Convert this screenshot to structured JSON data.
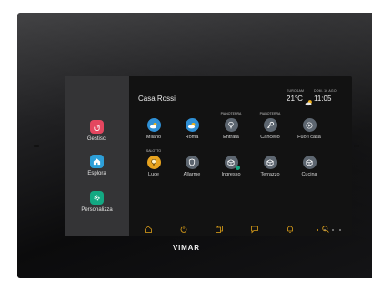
{
  "brand": "VIMAR",
  "sidebar": {
    "items": [
      {
        "label": "Gestisci",
        "icon": "hand-pointer-icon",
        "color": "#e4465f"
      },
      {
        "label": "Esplora",
        "icon": "house-icon",
        "color": "#2d9fd8"
      },
      {
        "label": "Personalizza",
        "icon": "gear-icon",
        "color": "#13a882"
      }
    ]
  },
  "header": {
    "title": "Casa Rossi",
    "weather": {
      "location": "EUROSAM",
      "temperature": "21°C",
      "date": "DOM. 16 AGO",
      "time": "11:05",
      "icon": "partly-cloudy-icon"
    }
  },
  "tiles": {
    "row1": [
      {
        "label": "Milano",
        "icon": "weather-icon",
        "color": "#2f90d6"
      },
      {
        "label": "Roma",
        "icon": "weather-icon",
        "color": "#2f90d6"
      },
      {
        "label": "Entrata",
        "sublabel": "PIANOTERRA",
        "icon": "lightbulb-icon",
        "color": "#5d6670"
      },
      {
        "label": "Cancello",
        "sublabel": "PIANOTERRA",
        "icon": "key-icon",
        "color": "#5d6670"
      },
      {
        "label": "Fuori casa",
        "icon": "play-icon",
        "color": "#5d6670"
      }
    ],
    "row2": [
      {
        "label": "Luce",
        "sublabel": "SALOTTO",
        "icon": "lightbulb-icon",
        "color": "#e7a31f"
      },
      {
        "label": "Allarme",
        "icon": "shield-icon",
        "color": "#5d6670"
      },
      {
        "label": "Ingresso",
        "icon": "cube-icon",
        "color": "#5d6670"
      },
      {
        "label": "Terrazzo",
        "icon": "cube-icon",
        "color": "#5d6670"
      },
      {
        "label": "Cucina",
        "icon": "cube-icon",
        "color": "#5d6670"
      }
    ]
  },
  "bottom_nav": [
    "home-icon",
    "power-icon",
    "copy-icon",
    "chat-icon",
    "bell-icon",
    "search-icon"
  ],
  "accent": "#e0a21a"
}
